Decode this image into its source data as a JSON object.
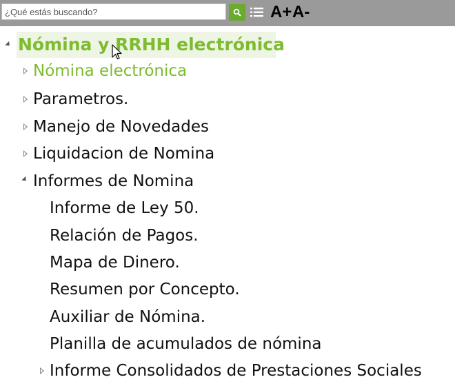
{
  "toolbar": {
    "search_placeholder": "¿Qué estás buscando?",
    "font_increase_label": "A+",
    "font_decrease_label": "A-",
    "accent_color": "#6aaa2c"
  },
  "tree": {
    "root": {
      "label": "Nómina y RRHH electrónica",
      "expanded": true,
      "color": "#7dbb2f"
    },
    "items": [
      {
        "label": "Nómina electrónica",
        "expanded": false,
        "highlighted": true
      },
      {
        "label": "Parametros.",
        "expanded": false
      },
      {
        "label": "Manejo de Novedades",
        "expanded": false
      },
      {
        "label": "Liquidacion de Nomina",
        "expanded": false
      },
      {
        "label": "Informes de Nomina",
        "expanded": true,
        "children": [
          {
            "label": "Informe de Ley 50."
          },
          {
            "label": "Relación de Pagos."
          },
          {
            "label": "Mapa de Dinero."
          },
          {
            "label": "Resumen por Concepto."
          },
          {
            "label": "Auxiliar de Nómina."
          },
          {
            "label": "Planilla de acumulados de nómina"
          },
          {
            "label": "Informe Consolidados de Prestaciones Sociales",
            "expanded": false
          }
        ]
      }
    ]
  },
  "icons": {
    "search": "search-icon",
    "list": "list-icon",
    "expanded": "triangle-down-icon",
    "collapsed": "triangle-right-icon",
    "cursor": "mouse-pointer-icon"
  }
}
